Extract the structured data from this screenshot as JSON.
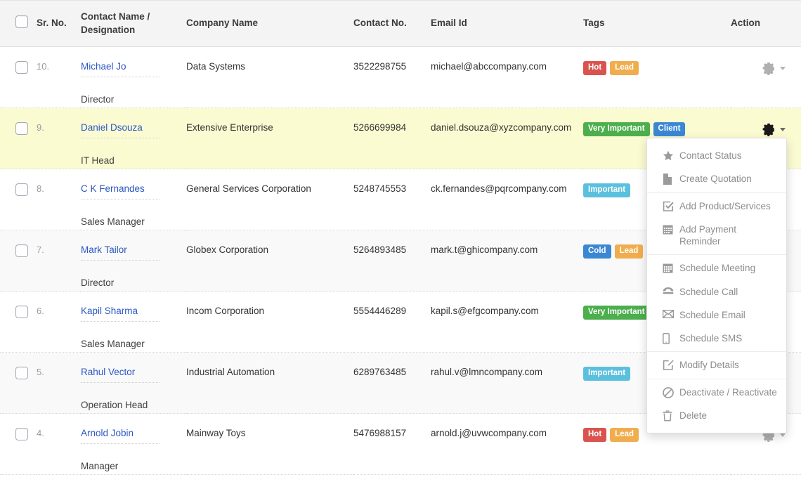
{
  "table": {
    "columns": [
      {
        "key": "checkbox",
        "label": ""
      },
      {
        "key": "srno",
        "label": "Sr. No."
      },
      {
        "key": "name",
        "label": "Contact Name / Designation"
      },
      {
        "key": "company",
        "label": "Company Name"
      },
      {
        "key": "phone",
        "label": "Contact No."
      },
      {
        "key": "email",
        "label": "Email Id"
      },
      {
        "key": "tags",
        "label": "Tags"
      },
      {
        "key": "action",
        "label": "Action"
      }
    ],
    "rows": [
      {
        "srno": "10.",
        "name": "Michael Jo",
        "designation": "Director",
        "company": "Data Systems",
        "phone": "3522298755",
        "email": "michael@abccompany.com",
        "tags": [
          {
            "label": "Hot",
            "style": "hot"
          },
          {
            "label": "Lead",
            "style": "lead"
          }
        ],
        "highlighted": false,
        "striped": false,
        "menu_open": false
      },
      {
        "srno": "9.",
        "name": "Daniel Dsouza",
        "designation": "IT Head",
        "company": "Extensive Enterprise",
        "phone": "5266699984",
        "email": "daniel.dsouza@xyzcompany.com",
        "tags": [
          {
            "label": "Very Important",
            "style": "vimp"
          },
          {
            "label": "Client",
            "style": "client"
          }
        ],
        "highlighted": true,
        "striped": false,
        "menu_open": true
      },
      {
        "srno": "8.",
        "name": "C K Fernandes",
        "designation": "Sales Manager",
        "company": "General Services Corporation",
        "phone": "5248745553",
        "email": "ck.fernandes@pqrcompany.com",
        "tags": [
          {
            "label": "Important",
            "style": "important"
          }
        ],
        "highlighted": false,
        "striped": false,
        "menu_open": false
      },
      {
        "srno": "7.",
        "name": "Mark Tailor",
        "designation": "Director",
        "company": "Globex Corporation",
        "phone": "5264893485",
        "email": "mark.t@ghicompany.com",
        "tags": [
          {
            "label": "Cold",
            "style": "cold"
          },
          {
            "label": "Lead",
            "style": "lead"
          }
        ],
        "highlighted": false,
        "striped": true,
        "menu_open": false
      },
      {
        "srno": "6.",
        "name": "Kapil Sharma",
        "designation": "Sales Manager",
        "company": "Incom Corporation",
        "phone": "5554446289",
        "email": "kapil.s@efgcompany.com",
        "tags": [
          {
            "label": "Very Important",
            "style": "vimp"
          }
        ],
        "highlighted": false,
        "striped": false,
        "menu_open": false
      },
      {
        "srno": "5.",
        "name": "Rahul Vector",
        "designation": "Operation Head",
        "company": "Industrial Automation",
        "phone": "6289763485",
        "email": "rahul.v@lmncompany.com",
        "tags": [
          {
            "label": "Important",
            "style": "important"
          }
        ],
        "highlighted": false,
        "striped": true,
        "menu_open": false
      },
      {
        "srno": "4.",
        "name": "Arnold Jobin",
        "designation": "Manager",
        "company": "Mainway Toys",
        "phone": "5476988157",
        "email": "arnold.j@uvwcompany.com",
        "tags": [
          {
            "label": "Hot",
            "style": "hot"
          },
          {
            "label": "Lead",
            "style": "lead"
          }
        ],
        "highlighted": false,
        "striped": false,
        "menu_open": false
      }
    ]
  },
  "action_menu": {
    "groups": [
      {
        "items": [
          {
            "label": "Contact Status",
            "icon": "star-icon"
          },
          {
            "label": "Create Quotation",
            "icon": "document-icon"
          }
        ]
      },
      {
        "items": [
          {
            "label": "Add Product/Services",
            "icon": "check-square-icon"
          },
          {
            "label": "Add Payment Reminder",
            "icon": "calendar-icon"
          }
        ]
      },
      {
        "items": [
          {
            "label": "Schedule Meeting",
            "icon": "calendar-icon"
          },
          {
            "label": "Schedule Call",
            "icon": "phone-icon"
          },
          {
            "label": "Schedule Email",
            "icon": "envelope-icon"
          },
          {
            "label": "Schedule SMS",
            "icon": "mobile-icon"
          }
        ]
      },
      {
        "items": [
          {
            "label": "Modify Details",
            "icon": "pencil-square-icon"
          }
        ]
      },
      {
        "items": [
          {
            "label": "Deactivate / Reactivate",
            "icon": "ban-icon"
          },
          {
            "label": "Delete",
            "icon": "trash-icon"
          }
        ]
      }
    ]
  },
  "colors": {
    "hot": "#d9534f",
    "lead": "#f0ad4e",
    "important": "#5bc0de",
    "cold": "#3a87d4",
    "very_important": "#4cae4c",
    "client": "#3a87d4",
    "row_highlight": "#fbfbd2",
    "row_stripe": "#f9f9f9",
    "header_bg": "#f4f4f4",
    "link": "#2b57c4"
  }
}
